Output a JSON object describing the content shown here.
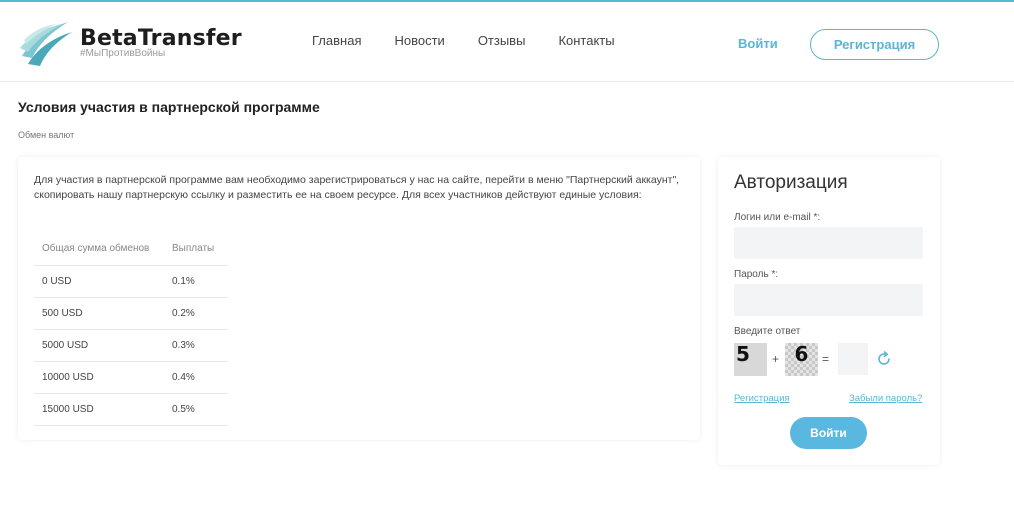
{
  "brand": {
    "name": "BetaTransfer",
    "tagline": "#МыПротивВойны",
    "accent": "#5ab5d6"
  },
  "nav": {
    "items": [
      "Главная",
      "Новости",
      "Отзывы",
      "Контакты"
    ]
  },
  "header": {
    "login_label": "Войти",
    "register_label": "Регистрация"
  },
  "page": {
    "title": "Условия участия в партнерской программе",
    "breadcrumb": "Обмен валют"
  },
  "content": {
    "intro": "Для участия в партнерской программе вам необходимо зарегистрироваться у нас на сайте, перейти в меню \"Партнерский аккаунт\", скопировать нашу партнерскую ссылку и разместить ее на своем ресурсе. Для всех участников действуют единые условия:",
    "table": {
      "headers": [
        "Общая сумма обменов",
        "Выплаты"
      ],
      "rows": [
        [
          "0 USD",
          "0.1%"
        ],
        [
          "500 USD",
          "0.2%"
        ],
        [
          "5000 USD",
          "0.3%"
        ],
        [
          "10000 USD",
          "0.4%"
        ],
        [
          "15000 USD",
          "0.5%"
        ]
      ]
    }
  },
  "auth": {
    "title": "Авторизация",
    "login_label": "Логин или e-mail *:",
    "login_value": "",
    "password_label": "Пароль *:",
    "password_value": "",
    "captcha_label": "Введите ответ",
    "captcha_a": "5",
    "captcha_op": "+",
    "captcha_b": "6",
    "captcha_eq": "=",
    "captcha_answer": "",
    "register_link": "Регистрация",
    "forgot_link": "Забыли пароль?",
    "submit_label": "Войти",
    "refresh_icon": "refresh-icon"
  }
}
